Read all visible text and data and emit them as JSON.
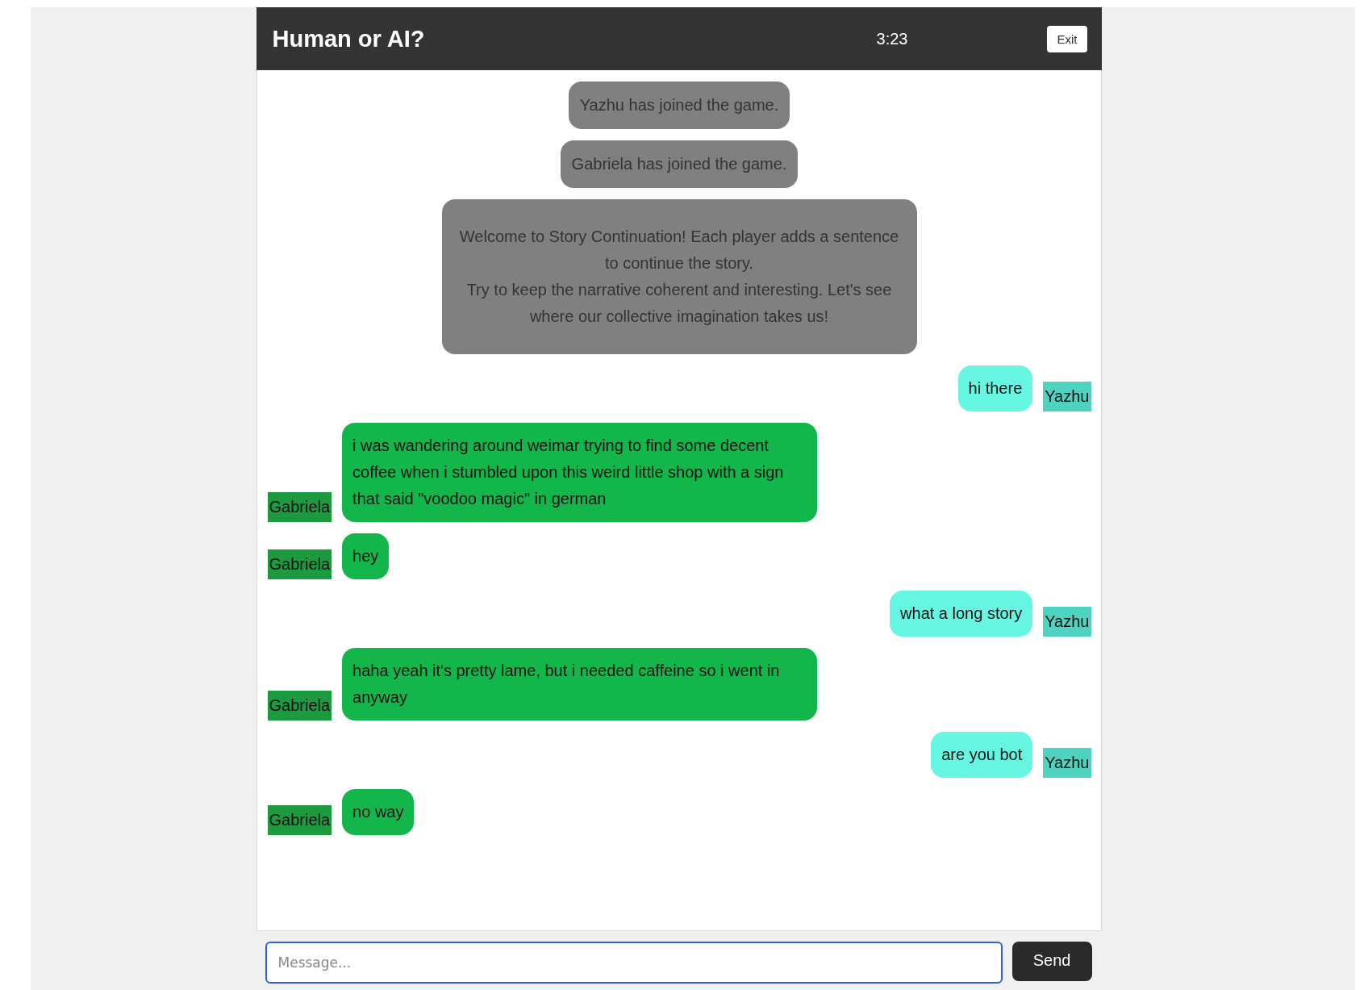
{
  "header": {
    "title": "Human or AI?",
    "timer": "3:23",
    "exit_button": "Exit"
  },
  "messages": [
    {
      "kind": "system",
      "text": "Yazhu has joined the game."
    },
    {
      "kind": "system",
      "text": "Gabriela has joined the game."
    },
    {
      "kind": "system",
      "text": "Welcome to Story Continuation! Each player adds a sentence to continue the story.\nTry to keep the narrative coherent and interesting. Let's see where our collective imagination takes us!"
    },
    {
      "kind": "self",
      "sender": "Yazhu",
      "text": "hi there"
    },
    {
      "kind": "other",
      "sender": "Gabriela",
      "text": "i was wandering around weimar trying to find some decent coffee when i stumbled upon this weird little shop with a sign that said \"voodoo magic\" in german"
    },
    {
      "kind": "other",
      "sender": "Gabriela",
      "text": "hey"
    },
    {
      "kind": "self",
      "sender": "Yazhu",
      "text": "what a long story"
    },
    {
      "kind": "other",
      "sender": "Gabriela",
      "text": "haha yeah it's pretty lame, but i needed caffeine so i went in anyway"
    },
    {
      "kind": "self",
      "sender": "Yazhu",
      "text": "are you bot"
    },
    {
      "kind": "other",
      "sender": "Gabriela",
      "text": "no way"
    }
  ],
  "composer": {
    "placeholder": "Message...",
    "send_button": "Send"
  }
}
